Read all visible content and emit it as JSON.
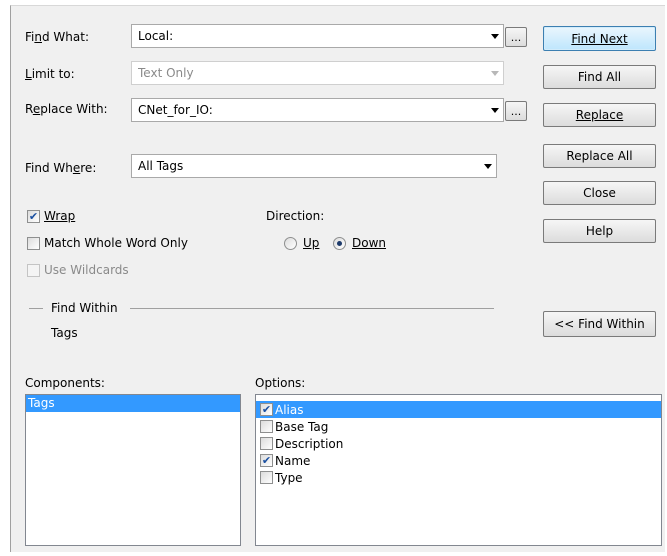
{
  "find_what": {
    "label": "Find What:",
    "value": "Local:",
    "browse_label": "..."
  },
  "limit_to": {
    "label": "Limit to:",
    "value": "Text Only"
  },
  "replace_with": {
    "label": "Replace With:",
    "value": "CNet_for_IO:",
    "browse_label": "..."
  },
  "find_where": {
    "label": "Find Where:",
    "value": "All Tags"
  },
  "options_left": {
    "wrap": {
      "label": "Wrap",
      "checked": true
    },
    "match_whole_word": {
      "label": "Match Whole Word Only",
      "checked": false
    },
    "use_wildcards": {
      "label": "Use Wildcards",
      "checked": false,
      "disabled": true
    }
  },
  "direction": {
    "label": "Direction:",
    "up_label": "Up",
    "down_label": "Down",
    "selected": "Down"
  },
  "find_within": {
    "title": "Find Within",
    "value": "Tags"
  },
  "buttons": {
    "find_next": "Find Next",
    "find_all": "Find All",
    "replace": "Replace",
    "replace_all": "Replace All",
    "close": "Close",
    "help": "Help",
    "find_within_toggle": "<< Find Within"
  },
  "components": {
    "label": "Components:",
    "items": [
      "Tags"
    ],
    "selected": "Tags"
  },
  "options": {
    "label": "Options:",
    "items": [
      {
        "label": "Alias",
        "checked": true,
        "selected": true
      },
      {
        "label": "Base Tag",
        "checked": false,
        "selected": false
      },
      {
        "label": "Description",
        "checked": false,
        "selected": false
      },
      {
        "label": "Name",
        "checked": true,
        "selected": false
      },
      {
        "label": "Type",
        "checked": false,
        "selected": false
      }
    ]
  },
  "icons": {
    "check": "checkmark-icon",
    "dropdown": "chevron-down-icon"
  },
  "colors": {
    "selection": "#3399ff",
    "dialog_bg": "#f0f0f0",
    "default_button": "#bee6fd"
  }
}
